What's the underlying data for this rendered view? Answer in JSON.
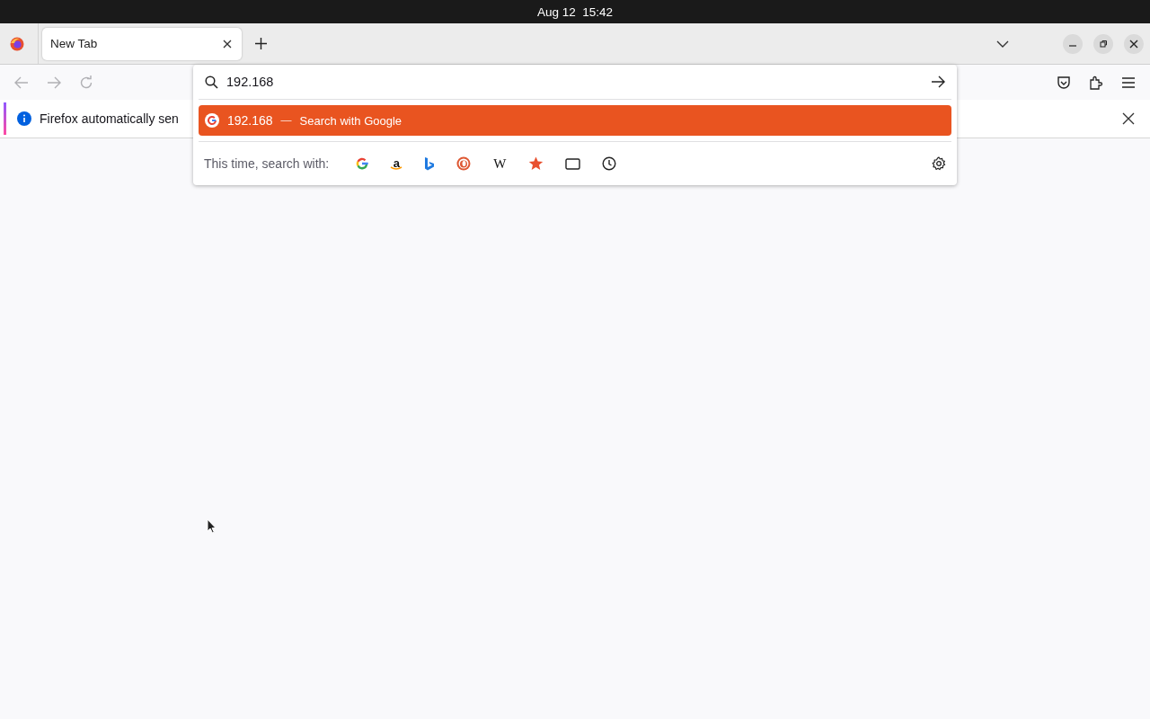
{
  "top_bar": {
    "clock": "Aug 12  15:42"
  },
  "tabs": [
    {
      "title": "New Tab",
      "selected": true
    }
  ],
  "nav": {
    "back_disabled": true,
    "forward_disabled": true
  },
  "url_bar": {
    "value": "192.168"
  },
  "suggestions": [
    {
      "text": "192.168",
      "separator": "—",
      "action": "Search with Google",
      "selected": true
    }
  ],
  "search_with": {
    "label": "This time, search with:",
    "engines": [
      {
        "kind": "google"
      },
      {
        "kind": "amazon",
        "glyph": "a"
      },
      {
        "kind": "bing"
      },
      {
        "kind": "duckduckgo"
      },
      {
        "kind": "wikipedia",
        "glyph": "W"
      },
      {
        "kind": "bookmarks"
      },
      {
        "kind": "tabs"
      },
      {
        "kind": "history"
      }
    ]
  },
  "notification": {
    "text": "Firefox automatically sen"
  }
}
